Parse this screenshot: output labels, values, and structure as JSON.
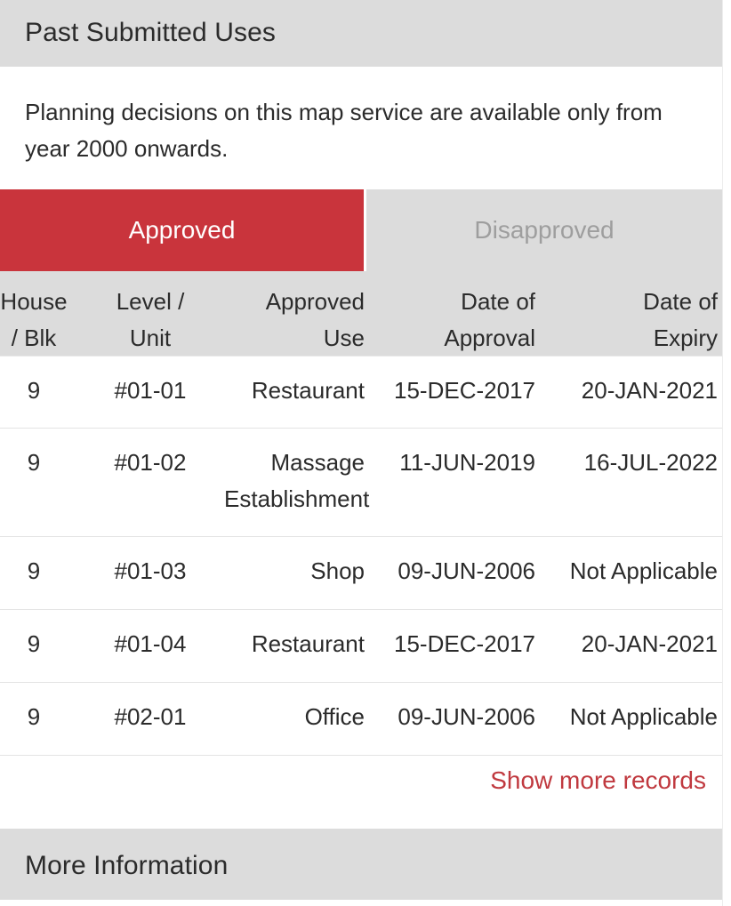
{
  "sections": {
    "past_submitted_uses_title": "Past Submitted Uses",
    "more_information_title": "More Information"
  },
  "intro": {
    "text": "Planning decisions on this map service are available only from year 2000 onwards."
  },
  "tabs": [
    {
      "label": "Approved",
      "state": "active"
    },
    {
      "label": "Disapproved",
      "state": "inactive"
    }
  ],
  "colors": {
    "tab_active_background": "#c9343c",
    "tab_active_text": "#ffffff",
    "tab_inactive_background": "#dcdcdc",
    "tab_inactive_text": "#9e9e9e",
    "section_bar_background": "#dcdcdc",
    "link_red": "#c0393f",
    "body_text": "#2b2b2b"
  },
  "table": {
    "headers": [
      "House / Blk",
      "Level / Unit",
      "Approved Use",
      "Date of Approval",
      "Date of Expiry"
    ],
    "header_lines": [
      [
        "House",
        "/ Blk"
      ],
      [
        "Level /",
        "Unit"
      ],
      [
        "Approved",
        "Use"
      ],
      [
        "Date of",
        "Approval"
      ],
      [
        "Date of",
        "Expiry"
      ]
    ],
    "rows": [
      {
        "house_blk": "9",
        "level_unit": "#01-01",
        "approved_use": "Restaurant",
        "date_of_approval": "15-DEC-2017",
        "date_of_expiry": "20-JAN-2021"
      },
      {
        "house_blk": "9",
        "level_unit": "#01-02",
        "approved_use": "Massage Establishment",
        "date_of_approval": "11-JUN-2019",
        "date_of_expiry": "16-JUL-2022"
      },
      {
        "house_blk": "9",
        "level_unit": "#01-03",
        "approved_use": "Shop",
        "date_of_approval": "09-JUN-2006",
        "date_of_expiry": "Not Applicable"
      },
      {
        "house_blk": "9",
        "level_unit": "#01-04",
        "approved_use": "Restaurant",
        "date_of_approval": "15-DEC-2017",
        "date_of_expiry": "20-JAN-2021"
      },
      {
        "house_blk": "9",
        "level_unit": "#02-01",
        "approved_use": "Office",
        "date_of_approval": "09-JUN-2006",
        "date_of_expiry": "Not Applicable"
      }
    ]
  },
  "actions": {
    "show_more_records": "Show more records"
  }
}
